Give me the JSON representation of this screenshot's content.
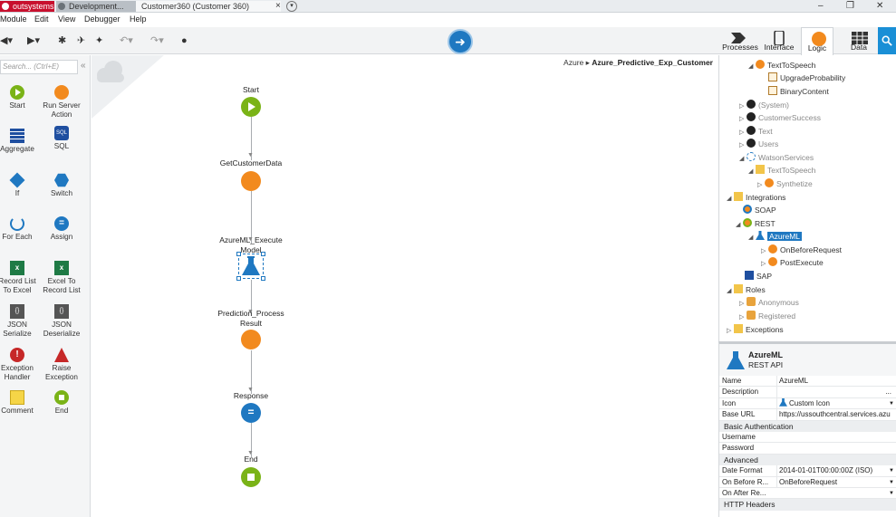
{
  "titlebar": {
    "tabs": [
      "outsystems",
      "Development...",
      "Customer360 (Customer 360)"
    ],
    "close_tab": "×",
    "window_controls": [
      "–",
      "❐",
      "✕"
    ]
  },
  "menu": [
    "Module",
    "Edit",
    "View",
    "Debugger",
    "Help"
  ],
  "right_tabs": [
    "Processes",
    "Interface",
    "Logic",
    "Data"
  ],
  "palette": {
    "search_placeholder": "Search... (Ctrl+E)",
    "collapse": "«",
    "items": [
      {
        "label": "Start",
        "icon": "start-icon"
      },
      {
        "label": "Run Server Action",
        "icon": "run-server-action-icon"
      },
      {
        "label": "Aggregate",
        "icon": "aggregate-icon"
      },
      {
        "label": "SQL",
        "icon": "sql-icon"
      },
      {
        "label": "If",
        "icon": "if-icon"
      },
      {
        "label": "Switch",
        "icon": "switch-icon"
      },
      {
        "label": "For Each",
        "icon": "for-each-icon"
      },
      {
        "label": "Assign",
        "icon": "assign-icon"
      },
      {
        "label": "Record List To Excel",
        "icon": "record-list-to-excel-icon"
      },
      {
        "label": "Excel To Record List",
        "icon": "excel-to-record-list-icon"
      },
      {
        "label": "JSON Serialize",
        "icon": "json-serialize-icon"
      },
      {
        "label": "JSON Deserialize",
        "icon": "json-deserialize-icon"
      },
      {
        "label": "Exception Handler",
        "icon": "exception-handler-icon"
      },
      {
        "label": "Raise Exception",
        "icon": "raise-exception-icon"
      },
      {
        "label": "Comment",
        "icon": "comment-icon"
      },
      {
        "label": "End",
        "icon": "end-icon"
      }
    ],
    "sql_icon_text": "SQL",
    "excel_icon_text": "x",
    "json_icon_text": "{}"
  },
  "canvas": {
    "breadcrumb_module": "Azure",
    "breadcrumb_sep": "▸",
    "breadcrumb_action": "Azure_Predictive_Exp_Customer",
    "nodes": [
      {
        "label": "Start",
        "kind": "start"
      },
      {
        "label": "GetCustomerData",
        "kind": "server-action"
      },
      {
        "label": "AzureML_Execute Model",
        "kind": "rest-method"
      },
      {
        "label": "Prediction_Process Result",
        "kind": "server-action"
      },
      {
        "label": "Response",
        "kind": "assign"
      },
      {
        "label": "End",
        "kind": "end"
      }
    ]
  },
  "tree": [
    {
      "text": "TextToSpeech",
      "icon": "action-icon"
    },
    {
      "text": "UpgradeProbability",
      "icon": "output-param-icon"
    },
    {
      "text": "BinaryContent",
      "icon": "output-param-icon"
    },
    {
      "text": "(System)",
      "icon": "module-icon"
    },
    {
      "text": "CustomerSuccess",
      "icon": "module-icon"
    },
    {
      "text": "Text",
      "icon": "module-icon"
    },
    {
      "text": "Users",
      "icon": "module-icon"
    },
    {
      "text": "WatsonServices",
      "icon": "service-icon"
    },
    {
      "text": "TextToSpeech",
      "icon": "folder-icon"
    },
    {
      "text": "Synthetize",
      "icon": "action-icon"
    },
    {
      "text": "Integrations",
      "icon": "folder-icon"
    },
    {
      "text": "SOAP",
      "icon": "soap-icon"
    },
    {
      "text": "REST",
      "icon": "rest-icon"
    },
    {
      "text": "AzureML",
      "icon": "rest-api-icon"
    },
    {
      "text": "OnBeforeRequest",
      "icon": "action-icon"
    },
    {
      "text": "PostExecute",
      "icon": "action-icon"
    },
    {
      "text": "SAP",
      "icon": "sap-icon"
    },
    {
      "text": "Roles",
      "icon": "folder-icon"
    },
    {
      "text": "Anonymous",
      "icon": "role-icon"
    },
    {
      "text": "Registered",
      "icon": "role-icon"
    },
    {
      "text": "Exceptions",
      "icon": "folder-icon"
    }
  ],
  "properties": {
    "title": "AzureML",
    "subtitle": "REST API",
    "rows": [
      {
        "key": "Name",
        "value": "AzureML"
      },
      {
        "key": "Description",
        "value": "..."
      },
      {
        "key": "Icon",
        "value": "Custom Icon"
      },
      {
        "key": "Base URL",
        "value": "https://ussouthcentral.services.azu"
      }
    ],
    "section_auth": "Basic Authentication",
    "auth_rows": [
      {
        "key": "Username",
        "value": ""
      },
      {
        "key": "Password",
        "value": ""
      }
    ],
    "section_advanced": "Advanced",
    "advanced_rows": [
      {
        "key": "Date Format",
        "value": "2014-01-01T00:00:00Z (ISO)"
      },
      {
        "key": "On Before R...",
        "value": "OnBeforeRequest"
      },
      {
        "key": "On After Re...",
        "value": ""
      }
    ],
    "section_headers": "HTTP Headers"
  },
  "colors": {
    "start": "#7ab317",
    "action": "#f28a1e",
    "assign": "#1f78c1",
    "brand": "#c8102e",
    "selection": "#1f78c1"
  }
}
